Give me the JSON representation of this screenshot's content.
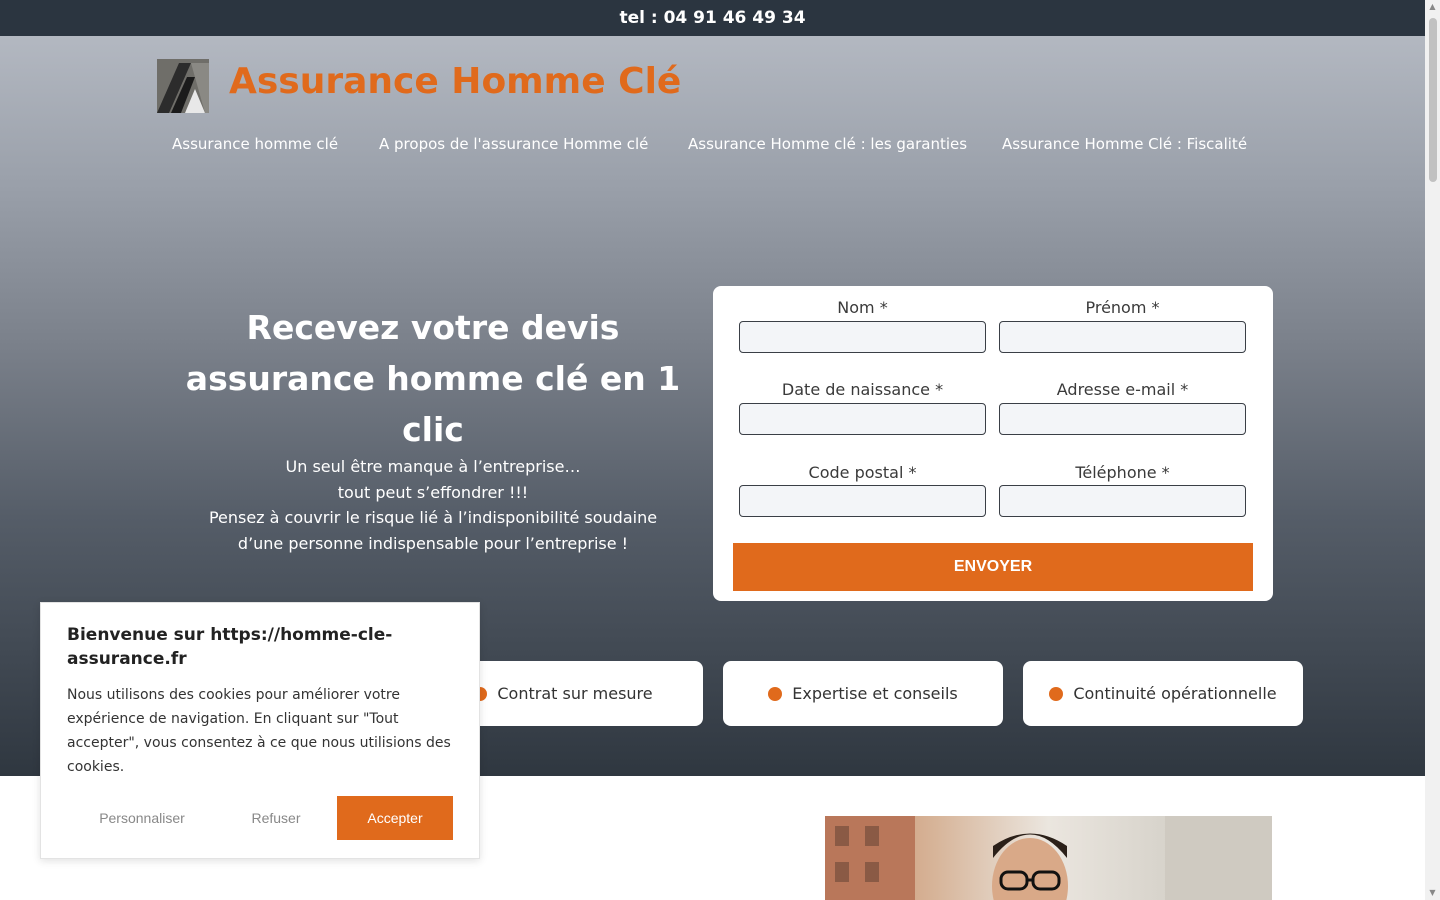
{
  "topbar": {
    "phone": "tel : 04 91 46 49 34"
  },
  "brand": {
    "name": "Assurance Homme Clé"
  },
  "nav": {
    "items": [
      {
        "label": "Assurance homme clé"
      },
      {
        "label": "A propos de l'assurance Homme clé"
      },
      {
        "label": "Assurance Homme clé : les garanties"
      },
      {
        "label": "Assurance Homme Clé : Fiscalité"
      }
    ]
  },
  "hero": {
    "title": "Recevez votre devis assurance homme clé en 1 clic",
    "lines": [
      "Un seul être manque à l’entreprise…",
      "tout peut s’effondrer !!!",
      "Pensez à couvrir le risque lié à l’indisponibilité soudaine",
      "d’une personne indispensable pour l’entreprise !"
    ]
  },
  "form": {
    "fields": [
      {
        "label": "Nom *",
        "value": ""
      },
      {
        "label": "Prénom *",
        "value": ""
      },
      {
        "label": "Date de naissance *",
        "value": ""
      },
      {
        "label": "Adresse e-mail *",
        "value": ""
      },
      {
        "label": "Code postal *",
        "value": ""
      },
      {
        "label": "Téléphone *",
        "value": ""
      }
    ],
    "submit": "ENVOYER"
  },
  "features": [
    {
      "label": "Contrat sur mesure"
    },
    {
      "label": "Expertise et conseils"
    },
    {
      "label": "Continuité opérationnelle"
    }
  ],
  "cookie": {
    "title": "Bienvenue sur https://homme-cle-assurance.fr",
    "text": "Nous utilisons des cookies pour améliorer votre expérience de navigation. En cliquant sur \"Tout accepter\", vous consentez à ce que nous utilisions des cookies.",
    "customize": "Personnaliser",
    "reject": "Refuser",
    "accept": "Accepter"
  },
  "colors": {
    "accent": "#e06a1c",
    "topbar": "#2b3540",
    "hero_bottom": "#2f3740"
  }
}
